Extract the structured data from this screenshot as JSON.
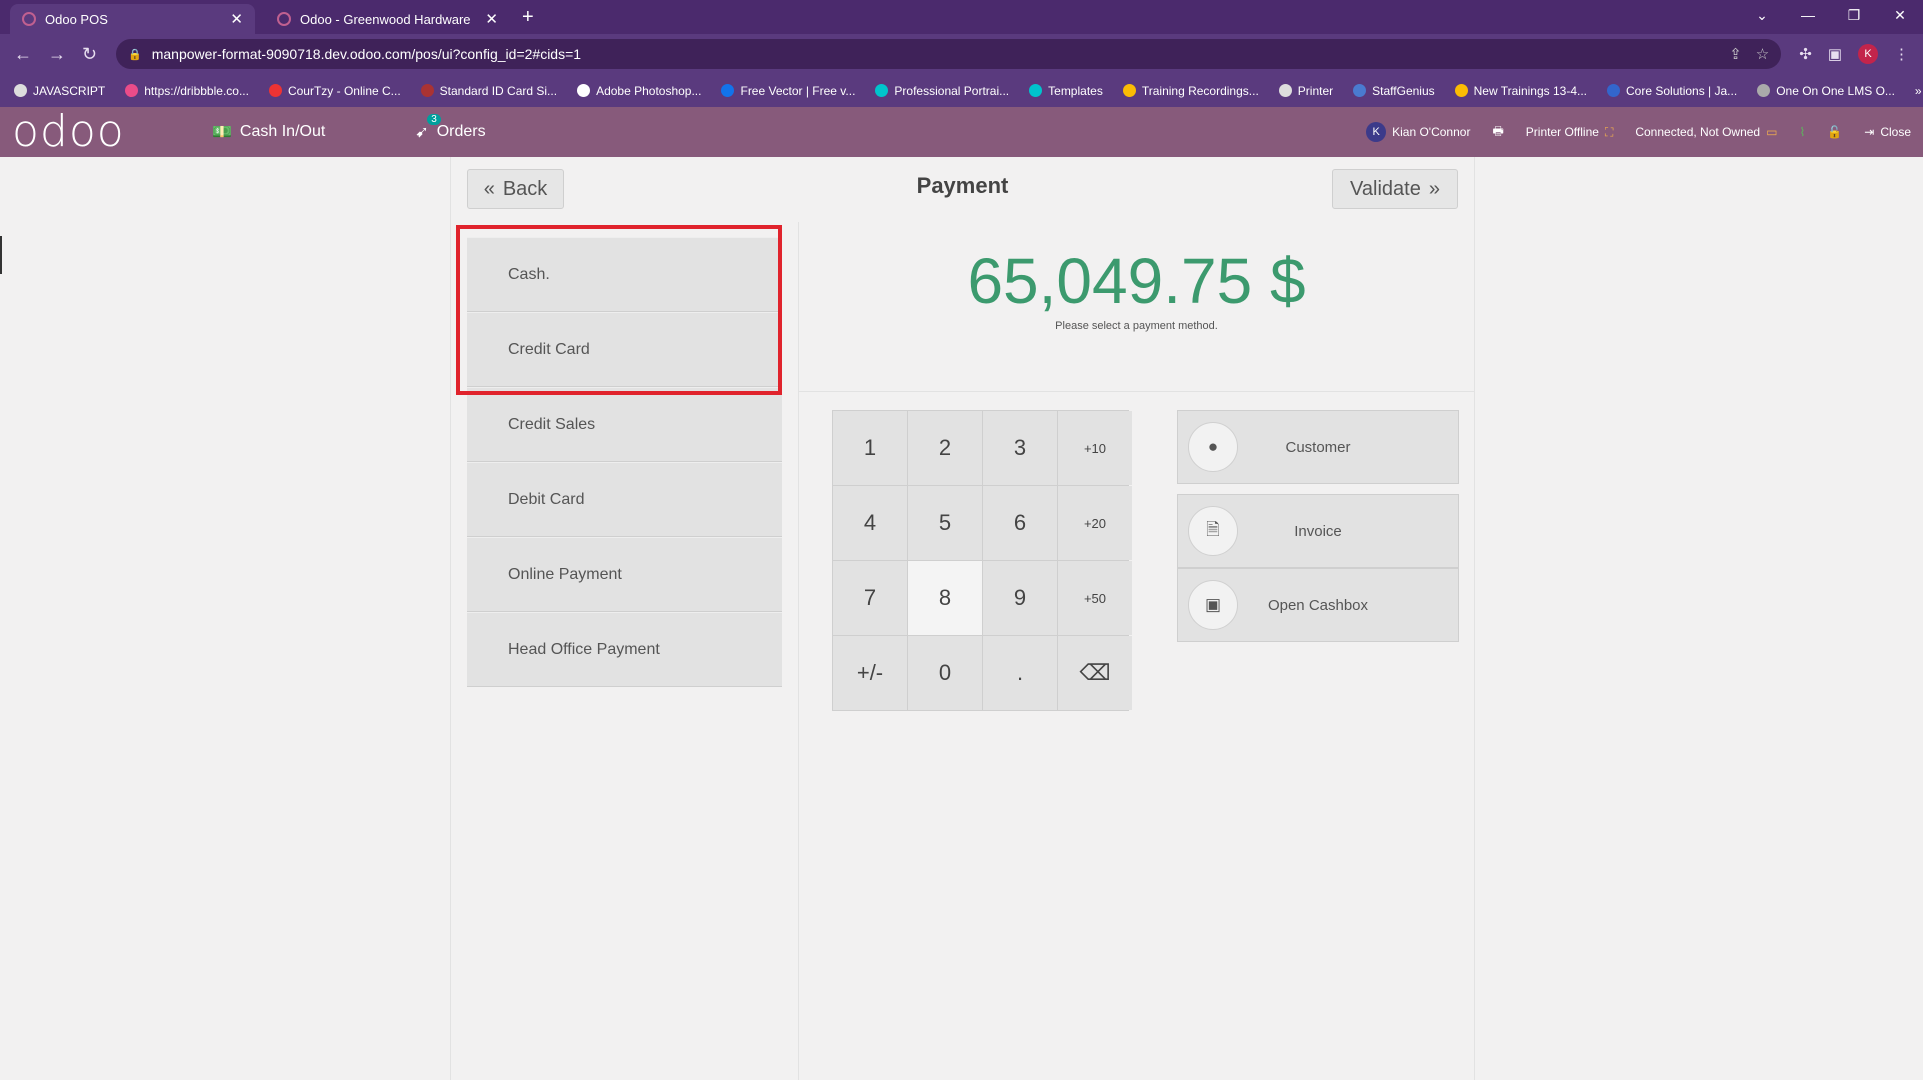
{
  "browser": {
    "tabs": [
      {
        "title": "Odoo POS",
        "active": true
      },
      {
        "title": "Odoo - Greenwood Hardware",
        "active": false
      }
    ],
    "url": "manpower-format-9090718.dev.odoo.com/pos/ui?config_id=2#cids=1",
    "profile_initial": "K",
    "bookmarks": [
      "JAVASCRIPT",
      "https://dribbble.co...",
      "CourTzy - Online C...",
      "Standard ID Card Si...",
      "Adobe Photoshop...",
      "Free Vector | Free v...",
      "Professional Portrai...",
      "Templates",
      "Training Recordings...",
      "Printer",
      "StaffGenius",
      "New Trainings 13-4...",
      "Core Solutions | Ja...",
      "One On One LMS O..."
    ]
  },
  "header": {
    "logo": "odoo",
    "cash_in_out": "Cash In/Out",
    "orders_label": "Orders",
    "orders_count": "3",
    "user_initial": "K",
    "user_name": "Kian O'Connor",
    "printer_status": "Printer Offline",
    "connection_status": "Connected, Not Owned",
    "close_label": "Close"
  },
  "payment": {
    "back_label": "Back",
    "title": "Payment",
    "validate_label": "Validate",
    "amount_due": "65,049.75 $",
    "hint": "Please select a payment method.",
    "methods": [
      "Cash.",
      "Credit Card",
      "Credit Sales",
      "Debit Card",
      "Online Payment",
      "Head Office Payment"
    ],
    "numpad": [
      "1",
      "2",
      "3",
      "+10",
      "4",
      "5",
      "6",
      "+20",
      "7",
      "8",
      "9",
      "+50",
      "+/-",
      "0",
      ".",
      "⌫"
    ],
    "actions": {
      "customer": "Customer",
      "invoice": "Invoice",
      "open_cashbox": "Open Cashbox"
    }
  },
  "colors": {
    "header": "#875a7b",
    "amount": "#3c9a6e",
    "highlight": "#e0232c"
  }
}
